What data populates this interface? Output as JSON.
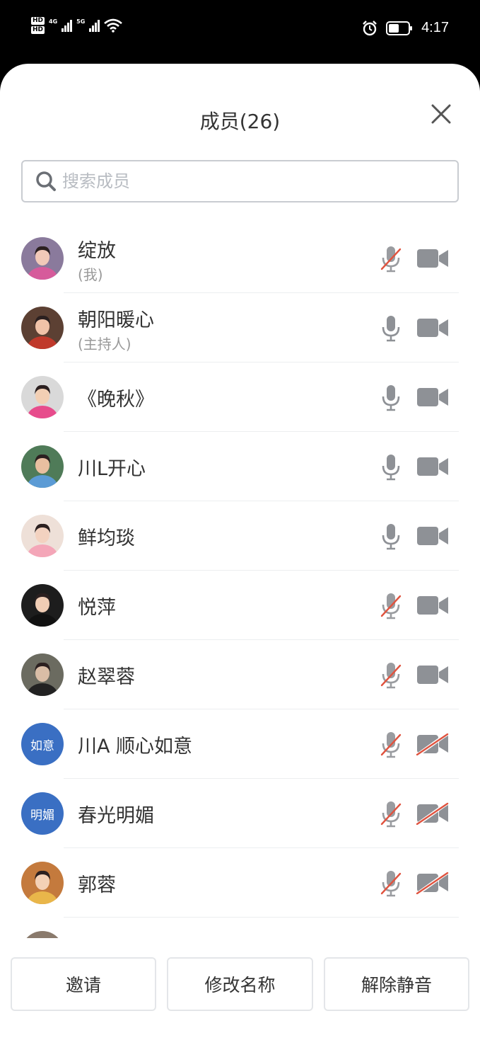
{
  "status_bar": {
    "hd1": "HD",
    "hd2": "HD",
    "net1": "4G",
    "net2": "5G",
    "time": "4:17",
    "icons": [
      "signal-icon",
      "wifi-icon",
      "alarm-icon",
      "battery-icon"
    ]
  },
  "dialog": {
    "title": "成员(26)",
    "close_icon": "close-icon",
    "search_placeholder": "搜索成员"
  },
  "members": [
    {
      "name": "绽放",
      "role": "(我)",
      "avatar": "photo",
      "mic": "muted",
      "camera": "on"
    },
    {
      "name": "朝阳暖心",
      "role": "(主持人)",
      "avatar": "photo",
      "mic": "on",
      "camera": "on"
    },
    {
      "name": "《晚秋》",
      "avatar": "photo",
      "mic": "on",
      "camera": "on"
    },
    {
      "name": "川L开心",
      "avatar": "photo",
      "mic": "on",
      "camera": "on"
    },
    {
      "name": "鲜均琰",
      "avatar": "photo",
      "mic": "on",
      "camera": "on"
    },
    {
      "name": "悦萍",
      "avatar": "photo",
      "mic": "muted",
      "camera": "on"
    },
    {
      "name": "赵翠蓉",
      "avatar": "photo",
      "mic": "muted",
      "camera": "on"
    },
    {
      "name": "川A 顺心如意",
      "avatar_text": "如意",
      "mic": "muted",
      "camera": "off"
    },
    {
      "name": "春光明媚",
      "avatar_text": "明媚",
      "mic": "muted",
      "camera": "off"
    },
    {
      "name": "郭蓉",
      "avatar": "photo",
      "mic": "muted",
      "camera": "off"
    }
  ],
  "buttons": {
    "invite": "邀请",
    "rename": "修改名称",
    "unmute": "解除静音"
  },
  "colors": {
    "icon_gray": "#8e9196",
    "muted_red": "#e0533f",
    "avatar_blue": "#3a6fc3"
  }
}
